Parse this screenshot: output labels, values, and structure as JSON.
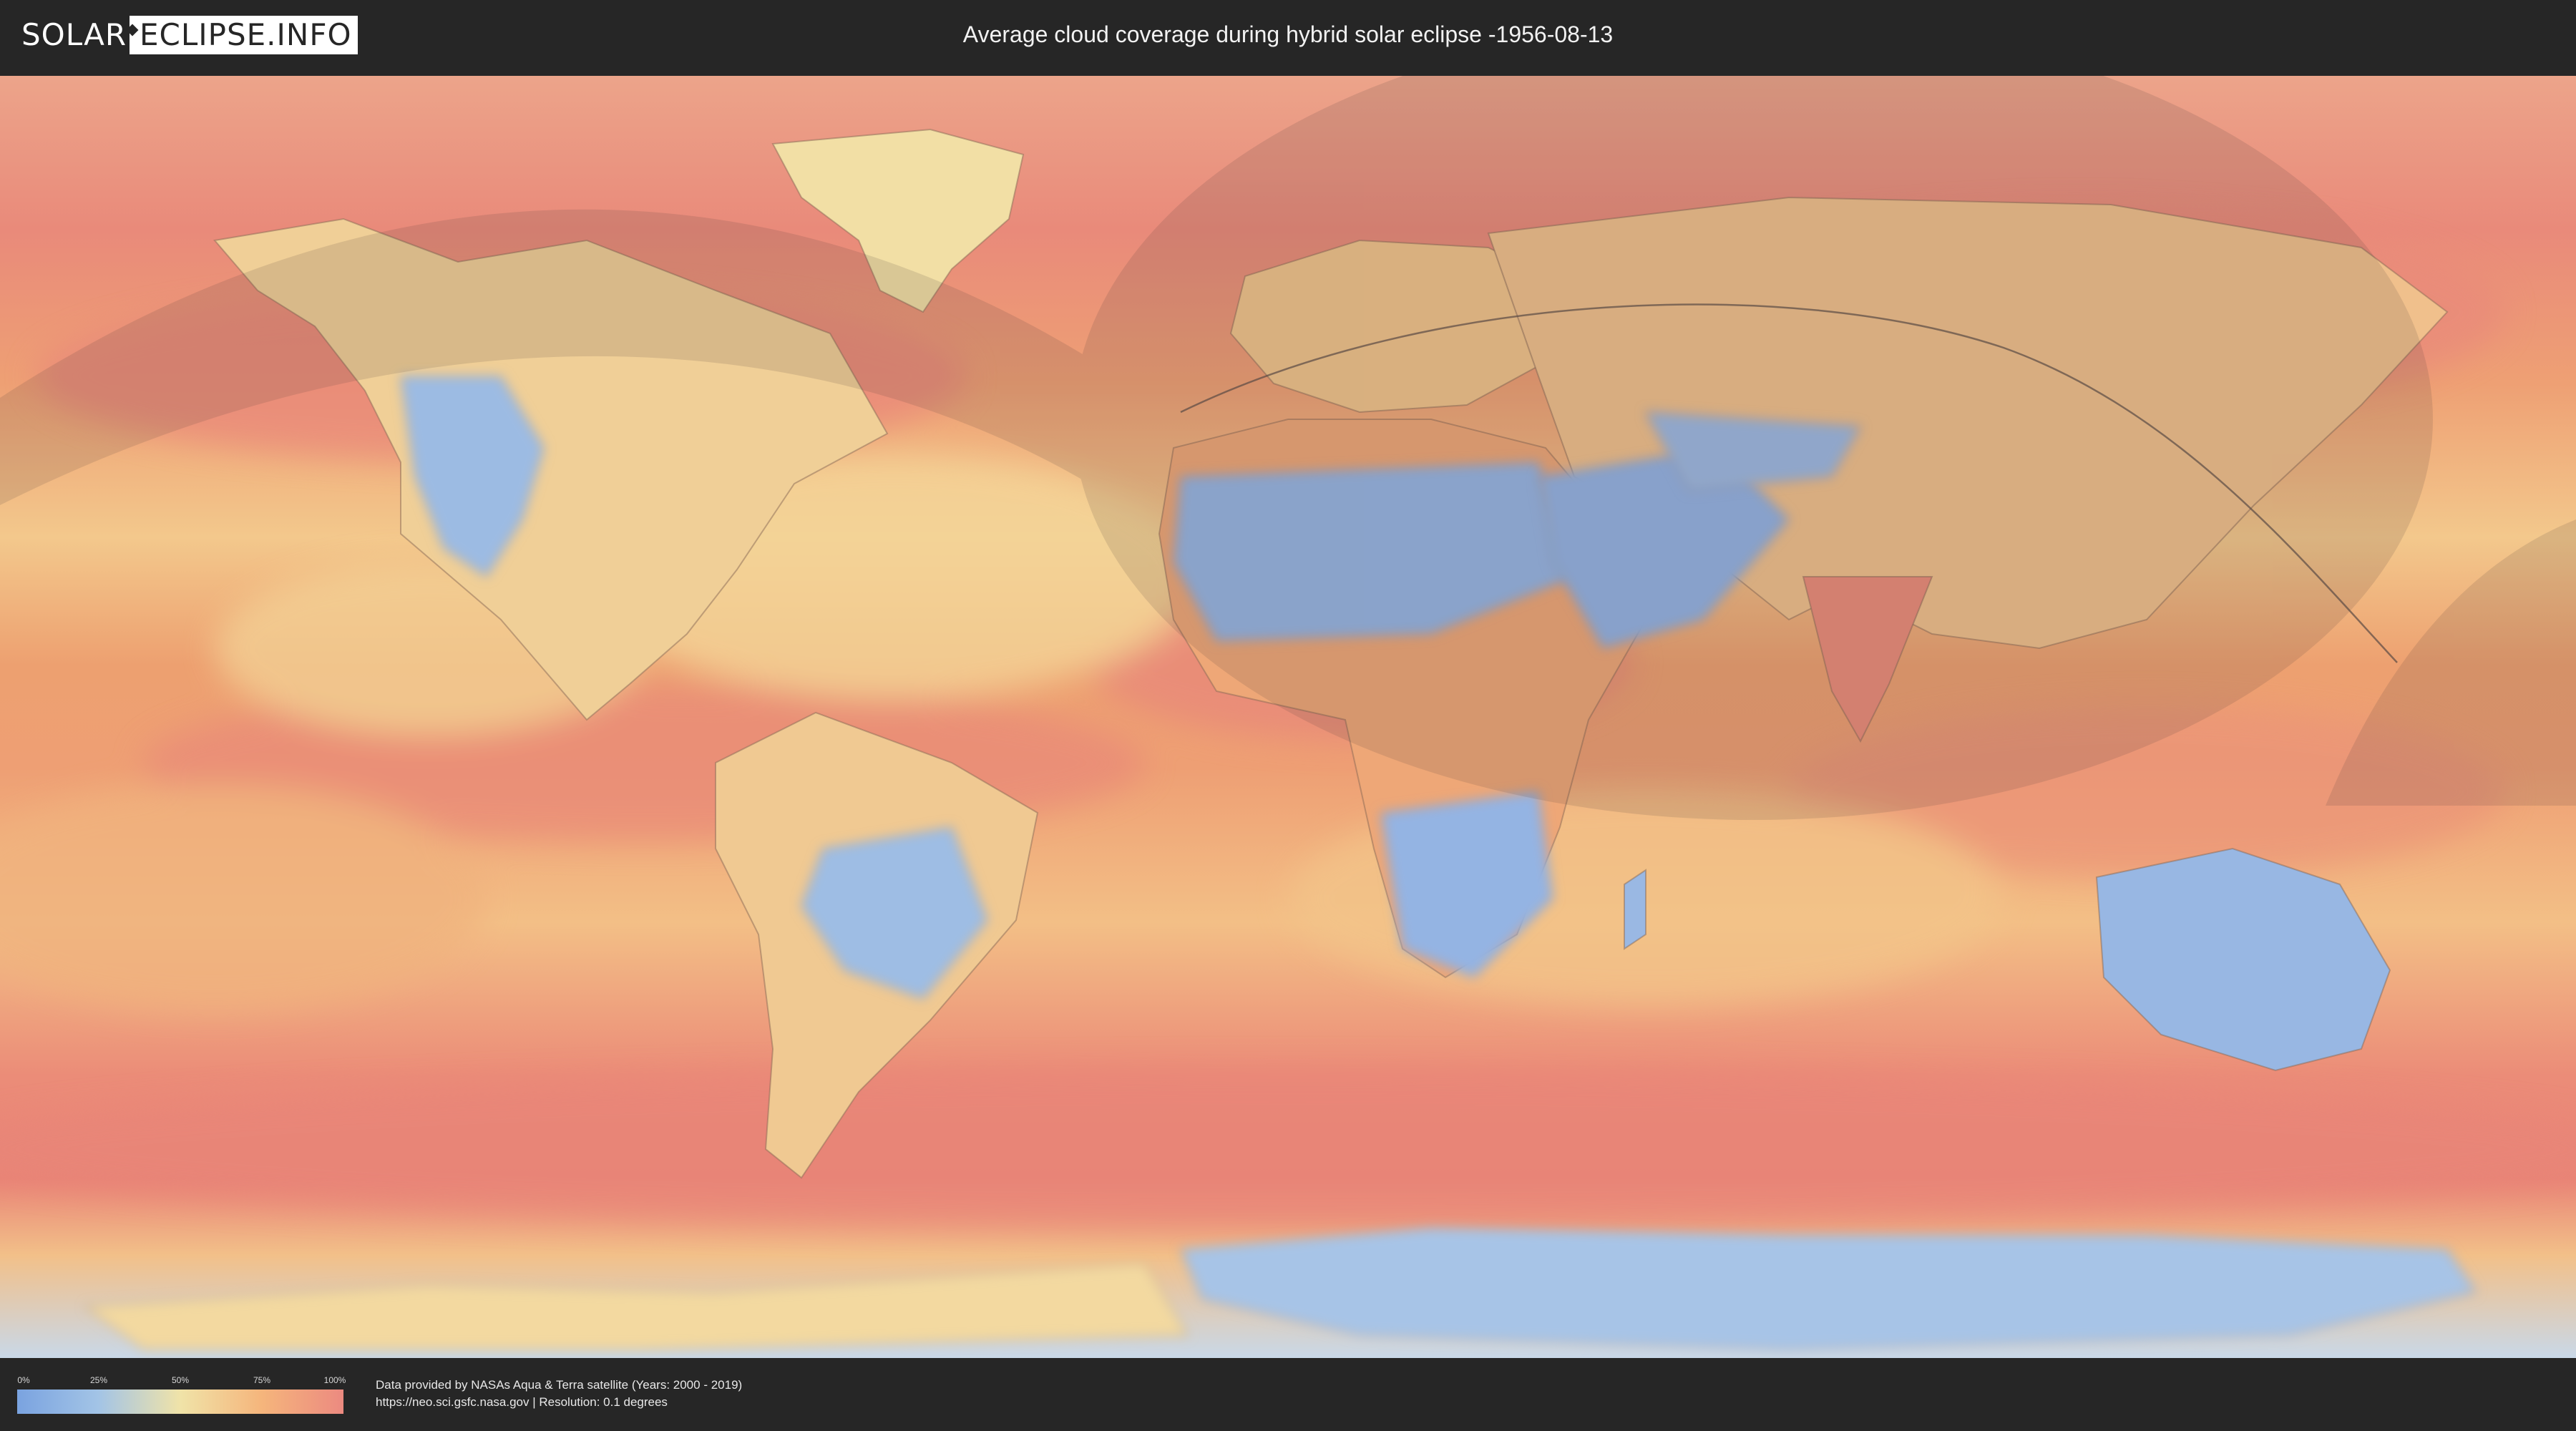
{
  "logo": {
    "part1": "SOLAR",
    "part2": "ECLIPSE.INFO"
  },
  "page": {
    "title": "Average cloud coverage during hybrid solar eclipse -1956-08-13"
  },
  "legend": {
    "ticks": [
      "0%",
      "25%",
      "50%",
      "75%",
      "100%"
    ],
    "colors": [
      "#7aa3e0",
      "#a3c4e6",
      "#f0e3a8",
      "#f5b57c",
      "#ec8a80"
    ]
  },
  "credits": {
    "line1": "Data provided by NASAs Aqua & Terra satellite (Years: 2000 - 2019)",
    "line2": "https://neo.sci.gsfc.nasa.gov | Resolution: 0.1 degrees"
  },
  "map": {
    "colors": {
      "ocean": "#e9a267",
      "cloudy": "#e98a7a",
      "clear": "#8fb0e2",
      "mid": "#f2d69a"
    }
  }
}
